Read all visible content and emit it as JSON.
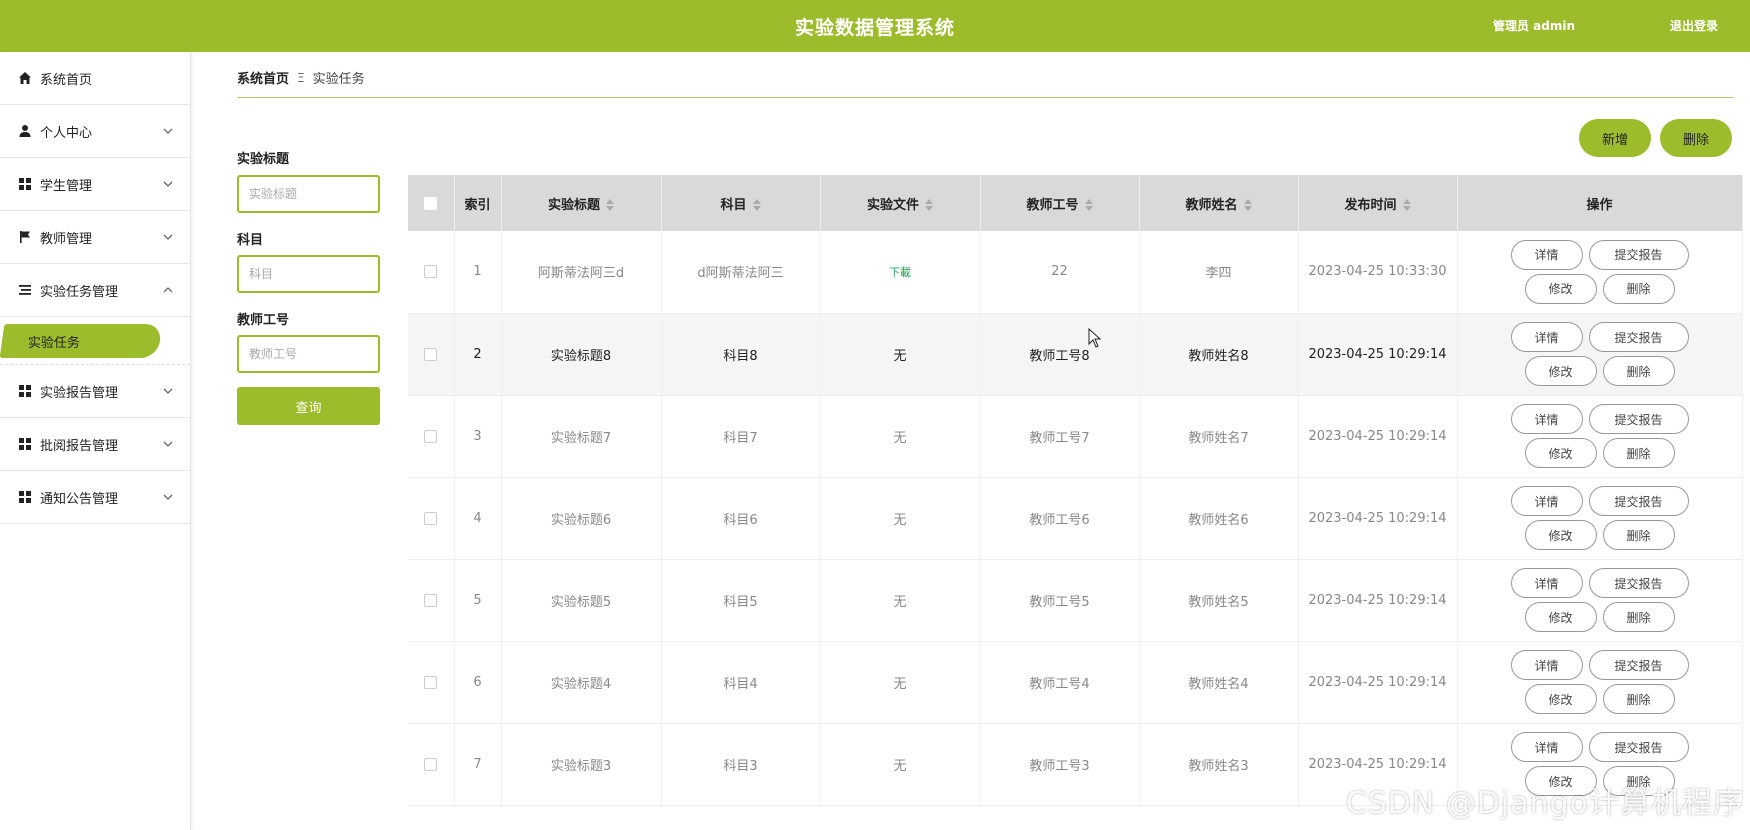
{
  "header": {
    "title": "实验数据管理系统",
    "user": "管理员 admin",
    "logout": "退出登录"
  },
  "sidebar": {
    "items": [
      {
        "label": "系统首页",
        "icon": "home-icon"
      },
      {
        "label": "个人中心",
        "icon": "user-icon"
      },
      {
        "label": "学生管理",
        "icon": "grid-icon"
      },
      {
        "label": "教师管理",
        "icon": "flag-icon"
      },
      {
        "label": "实验任务管理",
        "icon": "list-icon"
      },
      {
        "label": "实验报告管理",
        "icon": "grid-icon"
      },
      {
        "label": "批阅报告管理",
        "icon": "grid-icon"
      },
      {
        "label": "通知公告管理",
        "icon": "grid-icon"
      }
    ],
    "sub_item": "实验任务"
  },
  "breadcrumb": {
    "home": "系统首页",
    "separator": "Ξ",
    "current": "实验任务"
  },
  "filters": {
    "title_label": "实验标题",
    "title_placeholder": "实验标题",
    "subject_label": "科目",
    "subject_placeholder": "科目",
    "teacher_label": "教师工号",
    "teacher_placeholder": "教师工号",
    "query_button": "查询"
  },
  "actions": {
    "add": "新增",
    "delete": "删除"
  },
  "table": {
    "headers": [
      "索引",
      "实验标题",
      "科目",
      "实验文件",
      "教师工号",
      "教师姓名",
      "发布时间",
      "操作"
    ],
    "rows": [
      [
        "1",
        "阿斯蒂法阿三d",
        "d阿斯蒂法阿三",
        "下載",
        "22",
        "李四",
        "2023-04-25 10:33:30"
      ],
      [
        "2",
        "实验标题8",
        "科目8",
        "无",
        "教师工号8",
        "教师姓名8",
        "2023-04-25 10:29:14"
      ],
      [
        "3",
        "实验标题7",
        "科目7",
        "无",
        "教师工号7",
        "教师姓名7",
        "2023-04-25 10:29:14"
      ],
      [
        "4",
        "实验标题6",
        "科目6",
        "无",
        "教师工号6",
        "教师姓名6",
        "2023-04-25 10:29:14"
      ],
      [
        "5",
        "实验标题5",
        "科目5",
        "无",
        "教师工号5",
        "教师姓名5",
        "2023-04-25 10:29:14"
      ],
      [
        "6",
        "实验标题4",
        "科目4",
        "无",
        "教师工号4",
        "教师姓名4",
        "2023-04-25 10:29:14"
      ],
      [
        "7",
        "实验标题3",
        "科目3",
        "无",
        "教师工号3",
        "教师姓名3",
        "2023-04-25 10:29:14"
      ]
    ],
    "row_buttons": {
      "detail": "详情",
      "report": "提交报告",
      "edit": "修改",
      "delete": "删除"
    }
  },
  "watermark": "CSDN @Django计算机程序",
  "colors": {
    "accent": "#9cbc2c",
    "header_bg": "#d9d9d9",
    "download": "#2e9e5c"
  }
}
